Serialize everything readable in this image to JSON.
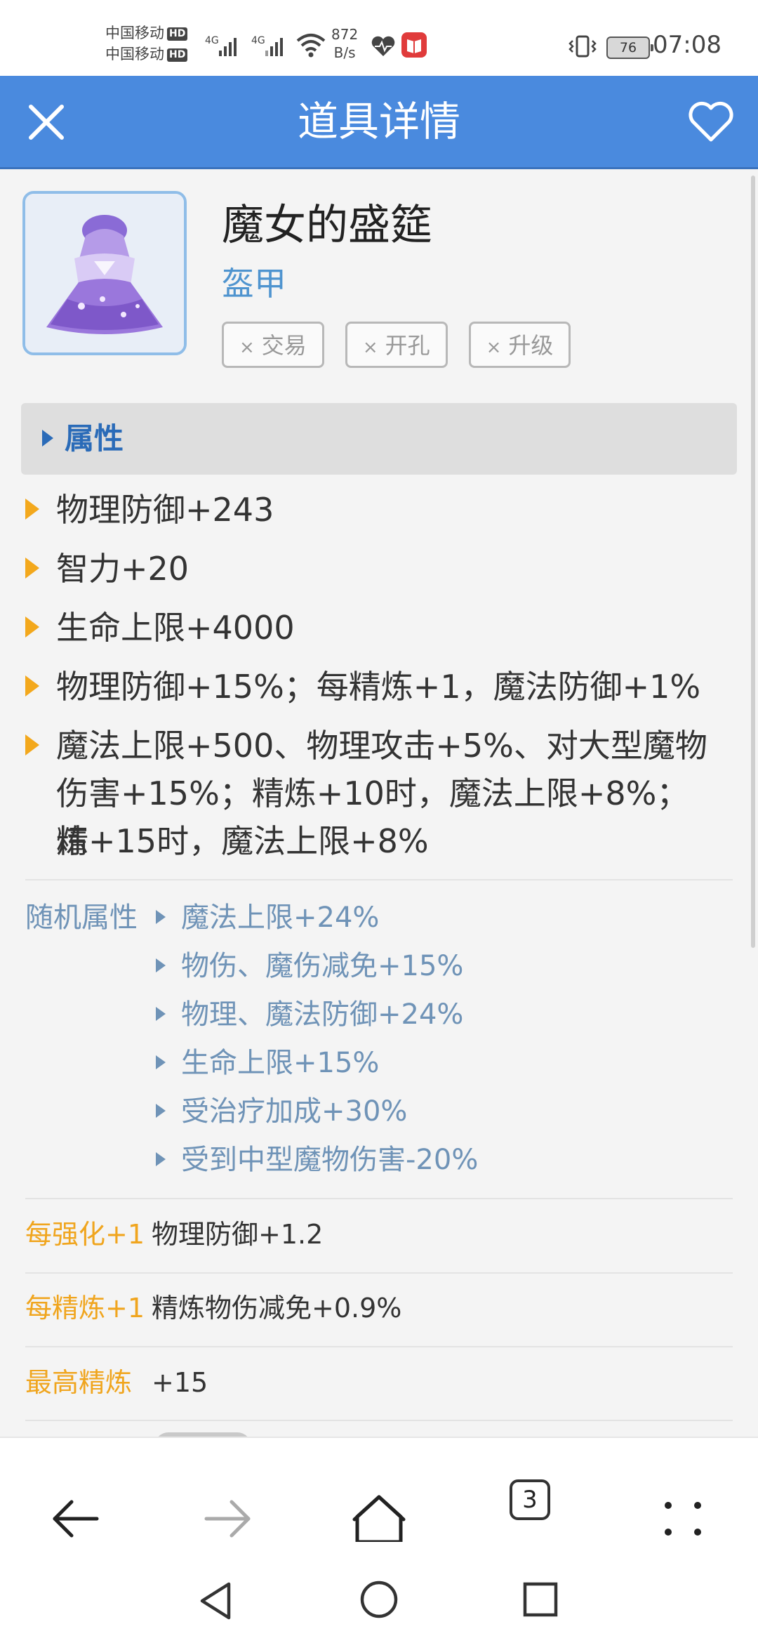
{
  "status_bar": {
    "carrier_1": "中国移动",
    "carrier_2": "中国移动",
    "hd_badge": "HD",
    "network_type": "4G",
    "speed_value": "872",
    "speed_unit": "B/s",
    "battery": "76",
    "time": "07:08"
  },
  "header": {
    "title": "道具详情"
  },
  "item": {
    "name": "魔女的盛筵",
    "type": "盔甲",
    "tags": [
      {
        "mark": "×",
        "label": "交易"
      },
      {
        "mark": "×",
        "label": "开孔"
      },
      {
        "mark": "×",
        "label": "升级"
      }
    ]
  },
  "section": {
    "title": "属性"
  },
  "attributes": [
    "物理防御+243",
    "智力+20",
    "生命上限+4000",
    "物理防御+15%；每精炼+1，魔法防御+1%",
    "魔法上限+500、物理攻击+5%、对大型魔物",
    "伤害+15%；精炼+10时，魔法上限+8%；精",
    "炼+15时，魔法上限+8%"
  ],
  "random_attributes": {
    "label": "随机属性",
    "items": [
      "魔法上限+24%",
      "物伤、魔伤减免+15%",
      "物理、魔法防御+24%",
      "生命上限+15%",
      "受治疗加成+30%",
      "受到中型魔物伤害-20%"
    ]
  },
  "upgrades": [
    {
      "key": "每强化+1",
      "value": "物理防御+1.2"
    },
    {
      "key": "每精炼+1",
      "value": "精炼物伤减免+0.9%"
    },
    {
      "key": "最高精炼",
      "value": "+15"
    }
  ],
  "browser_bar": {
    "tab_count": "3",
    "icons": [
      "back-arrow-icon",
      "forward-arrow-icon",
      "home-icon",
      "tabs-icon",
      "menu-dots-icon"
    ]
  },
  "nav_bar": {
    "icons": [
      "nav-back-icon",
      "nav-home-icon",
      "nav-recents-icon"
    ]
  },
  "colors": {
    "header_blue": "#4a8ade",
    "accent_orange": "#f3a81c",
    "section_blue": "#2a6bb8",
    "random_blue_grey": "#6f93b7",
    "type_blue": "#4f94cf"
  }
}
